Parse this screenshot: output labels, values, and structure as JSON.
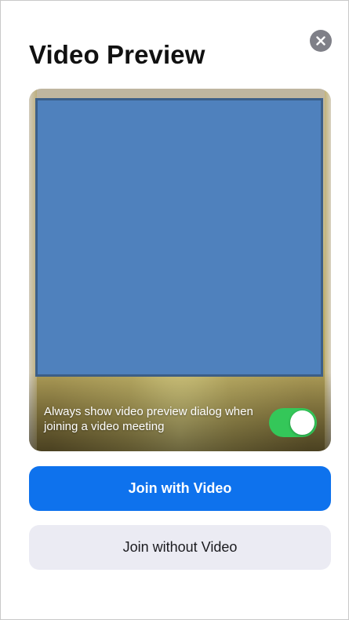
{
  "dialog": {
    "title": "Video Preview",
    "close_icon": "close-icon"
  },
  "preview": {
    "preference_text": "Always show video preview dialog when joining a video meeting",
    "toggle_on": true,
    "toggle_color": "#34c759"
  },
  "actions": {
    "join_with_video": "Join with Video",
    "join_without_video": "Join without Video",
    "primary_color": "#0e72ed",
    "secondary_color": "#ebebf3"
  }
}
